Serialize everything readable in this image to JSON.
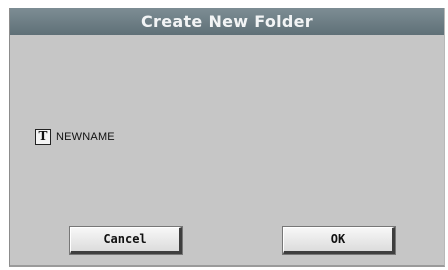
{
  "dialog": {
    "title": "Create New Folder",
    "name_field": {
      "icon": "text-edit-icon",
      "icon_glyph": "T",
      "value": "NEWNAME"
    },
    "buttons": {
      "cancel_label": "Cancel",
      "ok_label": "OK"
    }
  },
  "colors": {
    "title_bar": "#6b7c83",
    "background": "#c6c6c6"
  }
}
